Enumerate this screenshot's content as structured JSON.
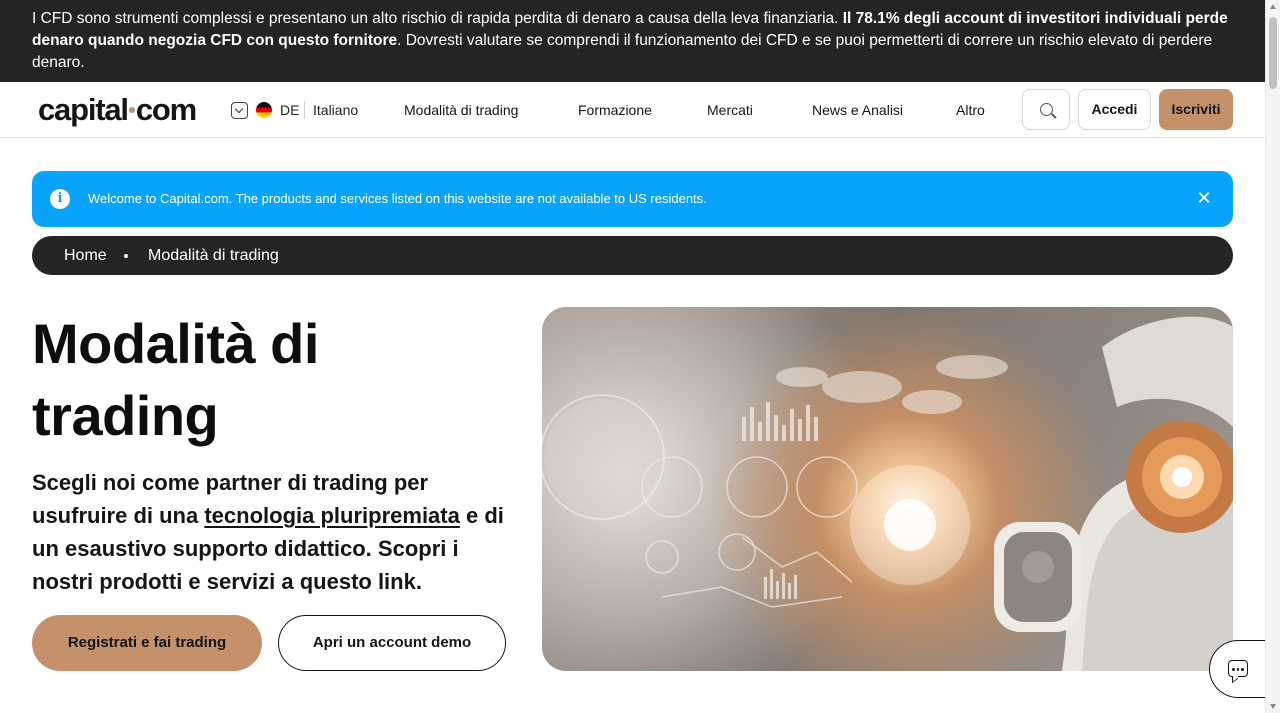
{
  "risk_warning": {
    "part1": "I CFD sono strumenti complessi e presentano un alto rischio di rapida perdita di denaro a causa della leva finanziaria. ",
    "bold": "Il 78.1% degli account di investitori individuali perde denaro quando negozia CFD con questo fornitore",
    "part2": ". Dovresti valutare se comprendi il funzionamento dei CFD e se puoi permetterti di correre un rischio elevato di perdere denaro."
  },
  "header": {
    "logo_left": "capital",
    "logo_right": "com",
    "lang_code": "DE",
    "lang_name": "Italiano",
    "nav": [
      "Modalità di trading",
      "Formazione",
      "Mercati",
      "News e Analisi",
      "Altro"
    ],
    "login_label": "Accedi",
    "signup_label": "Iscriviti"
  },
  "info_banner": {
    "text": "Welcome to Capital.com. The products and services listed on this website are not available to US residents."
  },
  "breadcrumb": {
    "home": "Home",
    "current": "Modalità di trading"
  },
  "hero": {
    "title_line1": "Modalità di",
    "title_line2": "trading",
    "subtitle_before": "Scegli noi come partner di trading per usufruire di una ",
    "subtitle_link": "tecnologia pluripremiata",
    "subtitle_after": " e di un esaustivo supporto didattico. Scopri i nostri prodotti e servizi a questo link.",
    "primary_cta": "Registrati e fai trading",
    "secondary_cta": "Apri un account demo"
  },
  "colors": {
    "accent": "#c4916a",
    "info_blue": "#0aa3fb",
    "dark": "#242424"
  },
  "icons": [
    "chevron-down-icon",
    "germany-flag-icon",
    "search-icon",
    "info-icon",
    "close-icon",
    "chat-icon"
  ]
}
